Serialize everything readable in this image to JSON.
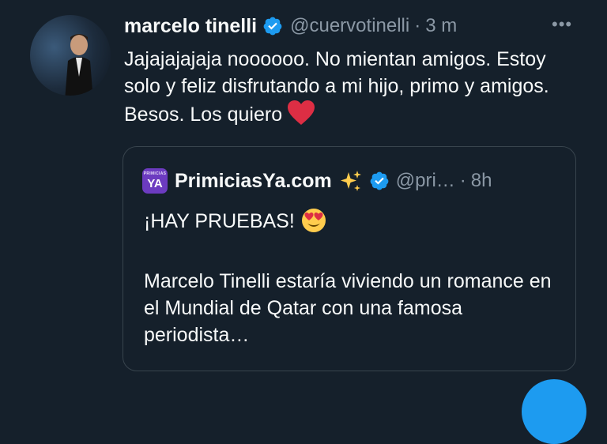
{
  "tweet": {
    "author_name": "marcelo tinelli",
    "handle": "@cuervotinelli",
    "separator": "·",
    "time": "3 m",
    "more": "•••",
    "text": "Jajajajajaja noooooo. No mientan amigos. Estoy solo y feliz disfrutando a mi hijo, primo y amigos. Besos. Los quiero",
    "emoji": "red-heart-icon"
  },
  "quoted_tweet": {
    "logo_small": "PRIMICIAS",
    "logo_big": "YA",
    "author_name": "PrimiciasYa.com",
    "handle": "@pri…",
    "separator": "·",
    "time": "8h",
    "line1": "¡HAY PRUEBAS!",
    "body": "Marcelo Tinelli estaría viviendo un romance en el Mundial de Qatar con una famosa periodista…"
  },
  "colors": {
    "background": "#15202b",
    "text": "#f7f9f9",
    "secondary_text": "#8b98a5",
    "verified_blue": "#1d9bf0",
    "border": "#38444d"
  }
}
